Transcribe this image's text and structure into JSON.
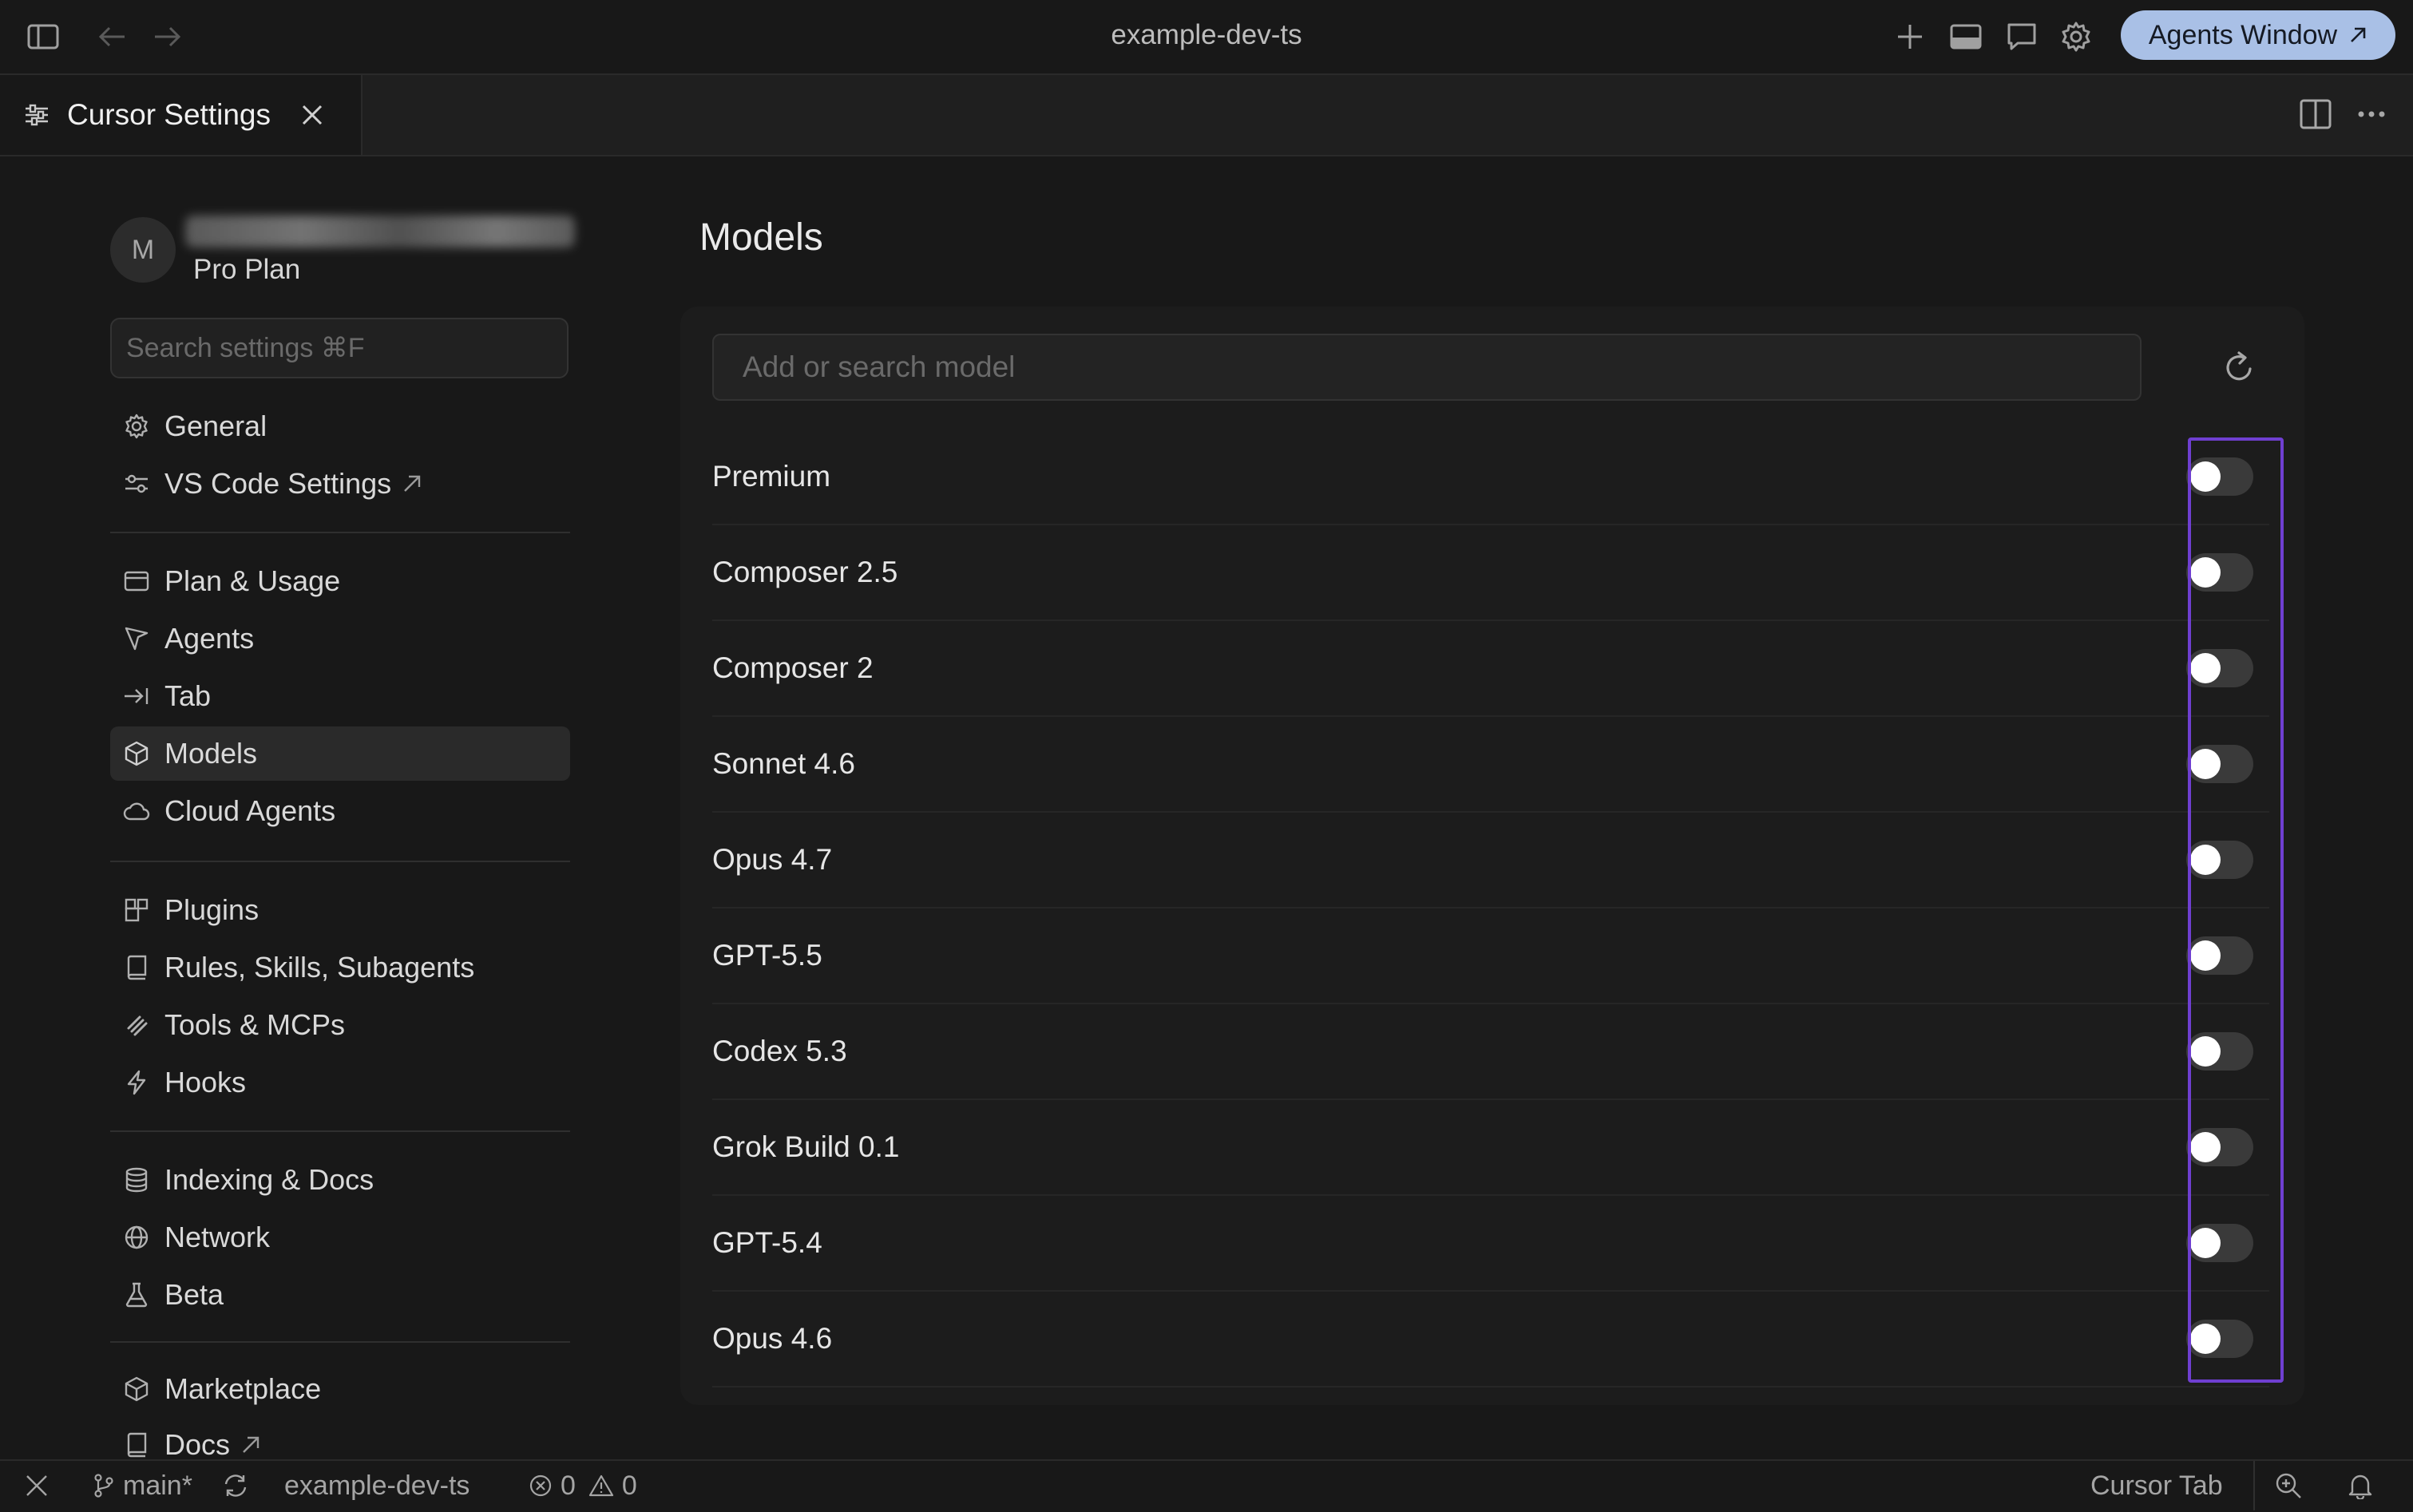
{
  "titlebar": {
    "title": "example-dev-ts",
    "agents_button": "Agents Window"
  },
  "tab": {
    "label": "Cursor Settings"
  },
  "account": {
    "avatar_letter": "M",
    "plan": "Pro Plan"
  },
  "search": {
    "placeholder": "Search settings ⌘F"
  },
  "nav": {
    "general": "General",
    "vscode": "VS Code Settings",
    "plan_usage": "Plan & Usage",
    "agents": "Agents",
    "tab": "Tab",
    "models": "Models",
    "cloud_agents": "Cloud Agents",
    "plugins": "Plugins",
    "rules": "Rules, Skills, Subagents",
    "tools": "Tools & MCPs",
    "hooks": "Hooks",
    "indexing": "Indexing & Docs",
    "network": "Network",
    "beta": "Beta",
    "marketplace": "Marketplace",
    "docs": "Docs"
  },
  "main": {
    "title": "Models",
    "search_placeholder": "Add or search model",
    "models": [
      {
        "name": "Premium",
        "enabled": false
      },
      {
        "name": "Composer 2.5",
        "enabled": false
      },
      {
        "name": "Composer 2",
        "enabled": false
      },
      {
        "name": "Sonnet 4.6",
        "enabled": false
      },
      {
        "name": "Opus 4.7",
        "enabled": false
      },
      {
        "name": "GPT-5.5",
        "enabled": false
      },
      {
        "name": "Codex 5.3",
        "enabled": false
      },
      {
        "name": "Grok Build 0.1",
        "enabled": false
      },
      {
        "name": "GPT-5.4",
        "enabled": false
      },
      {
        "name": "Opus 4.6",
        "enabled": false
      }
    ]
  },
  "statusbar": {
    "branch": "main*",
    "project": "example-dev-ts",
    "errors": "0",
    "warnings": "0",
    "cursor_tab": "Cursor Tab"
  },
  "colors": {
    "accent_button": "#a9c0e6",
    "highlight": "#6f3fd1",
    "background": "#181818"
  }
}
